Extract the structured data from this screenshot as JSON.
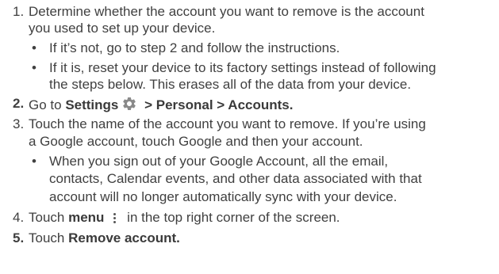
{
  "steps": [
    {
      "number": "1.",
      "lines": [
        "Determine whether the account you want to remove is the account",
        "you used to set up your device."
      ],
      "bullets": [
        {
          "lines": [
            "If it’s not, go to step 2 and follow the instructions."
          ]
        },
        {
          "lines": [
            "If it is, reset your device to its factory settings instead of following",
            "the steps below. This erases all of the data from your device."
          ]
        }
      ]
    },
    {
      "number": "2.",
      "prefix": "Go to ",
      "settings_label": "Settings",
      "icon": "gear-icon",
      "path": " > Personal > Accounts."
    },
    {
      "number": "3.",
      "lines": [
        "Touch the name of the account you want to remove. If you’re using",
        "a Google account, touch Google and then your account."
      ],
      "bullets": [
        {
          "lines": [
            "When you sign out of your Google Account, all the email,",
            "contacts, Calendar events, and other data associated with that",
            "account will no longer automatically sync with your device."
          ]
        }
      ]
    },
    {
      "number": "4.",
      "prefix": "Touch ",
      "menu_label": "menu",
      "icon": "more-vertical-icon",
      "suffix": " in the top right corner of the screen."
    },
    {
      "number": "5.",
      "prefix": "Touch ",
      "action_label": "Remove account."
    }
  ],
  "bullet_char": "•",
  "icon_color": "#8a8a8a"
}
